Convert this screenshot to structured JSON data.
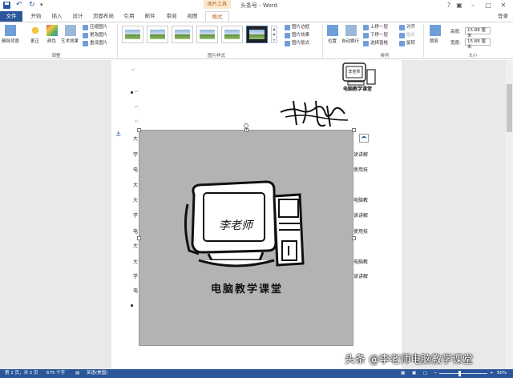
{
  "titlebar": {
    "doc_title": "头条号 - Word",
    "context_group": "图片工具",
    "signin": "登录"
  },
  "tabs": [
    {
      "label": "文件",
      "left": 0
    },
    {
      "label": "开始"
    },
    {
      "label": "插入"
    },
    {
      "label": "设计"
    },
    {
      "label": "页面布局"
    },
    {
      "label": "引用"
    },
    {
      "label": "邮件"
    },
    {
      "label": "审阅"
    },
    {
      "label": "视图"
    },
    {
      "label": "格式"
    }
  ],
  "ribbon": {
    "adjust": {
      "remove_bg": "删除背景",
      "corrections": "更正",
      "color": "颜色",
      "artistic": "艺术效果",
      "compress": "压缩图片",
      "change": "更改图片",
      "reset": "重设图片",
      "group_label": "调整"
    },
    "styles": {
      "border": "图片边框",
      "effects": "图片效果",
      "layout": "图片版式",
      "group_label": "图片样式"
    },
    "arrange": {
      "position": "位置",
      "wrap": "自动换行",
      "forward": "上移一层",
      "backward": "下移一层",
      "pane": "选择窗格",
      "align": "对齐",
      "group": "组合",
      "rotate": "旋转",
      "group_label": "排列"
    },
    "size": {
      "crop": "裁剪",
      "height_label": "高度:",
      "height_value": "15.88 厘米",
      "width_label": "宽度:",
      "width_value": "15.88 厘米",
      "group_label": "大小"
    }
  },
  "document": {
    "image_caption": "电脑教学课堂",
    "image_handwriting": "李老师",
    "small_caption": "电脑教学课堂",
    "small_handwriting": "李老师",
    "right_fragments": [
      "读讲解",
      "使用技",
      "电脑教",
      "读讲解",
      "使用技",
      "电脑教",
      "读讲解"
    ]
  },
  "statusbar": {
    "page": "第 1 页，共 2 页",
    "words": "675 个字",
    "language": "英语(美国)",
    "zoom": "90%"
  },
  "watermark": "头条 @李老师电脑教学课堂"
}
